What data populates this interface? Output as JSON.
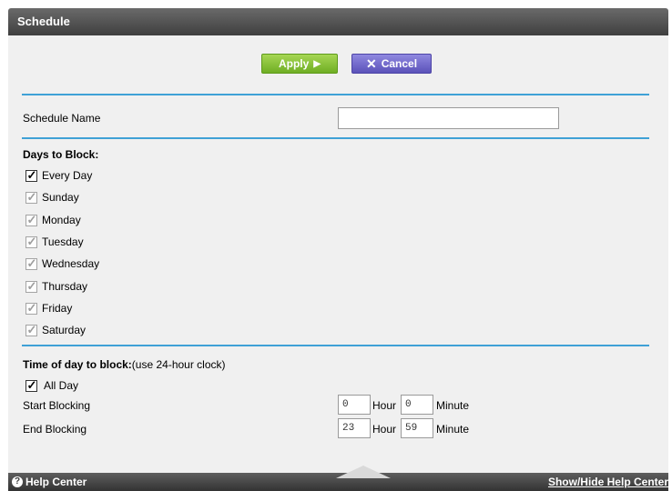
{
  "header": {
    "title": "Schedule"
  },
  "toolbar": {
    "apply_label": "Apply",
    "apply_glyph": "▶",
    "cancel_label": "Cancel",
    "cancel_glyph": "✕"
  },
  "schedule_name": {
    "label": "Schedule Name",
    "value": ""
  },
  "days": {
    "heading": "Days to Block:",
    "items": [
      {
        "label": "Every Day",
        "checked": true,
        "enabled": true
      },
      {
        "label": "Sunday",
        "checked": true,
        "enabled": false
      },
      {
        "label": "Monday",
        "checked": true,
        "enabled": false
      },
      {
        "label": "Tuesday",
        "checked": true,
        "enabled": false
      },
      {
        "label": "Wednesday",
        "checked": true,
        "enabled": false
      },
      {
        "label": "Thursday",
        "checked": true,
        "enabled": false
      },
      {
        "label": "Friday",
        "checked": true,
        "enabled": false
      },
      {
        "label": "Saturday",
        "checked": true,
        "enabled": false
      }
    ]
  },
  "time": {
    "heading": "Time of day to block:",
    "heading_note": "(use 24-hour clock)",
    "all_day_label": "All Day",
    "all_day_checked": true,
    "start_label": "Start Blocking",
    "start_hour": "0",
    "start_minute": "0",
    "end_label": "End Blocking",
    "end_hour": "23",
    "end_minute": "59",
    "hour_unit": "Hour",
    "minute_unit": "Minute"
  },
  "footer": {
    "help_center": "Help Center",
    "help_glyph": "?",
    "toggle_link": "Show/Hide Help Center"
  },
  "colors": {
    "separator": "#3fa1d6",
    "apply_green": "#7cbb2c",
    "cancel_purple": "#6a62c9",
    "title_bar": "#4a4a4a"
  }
}
